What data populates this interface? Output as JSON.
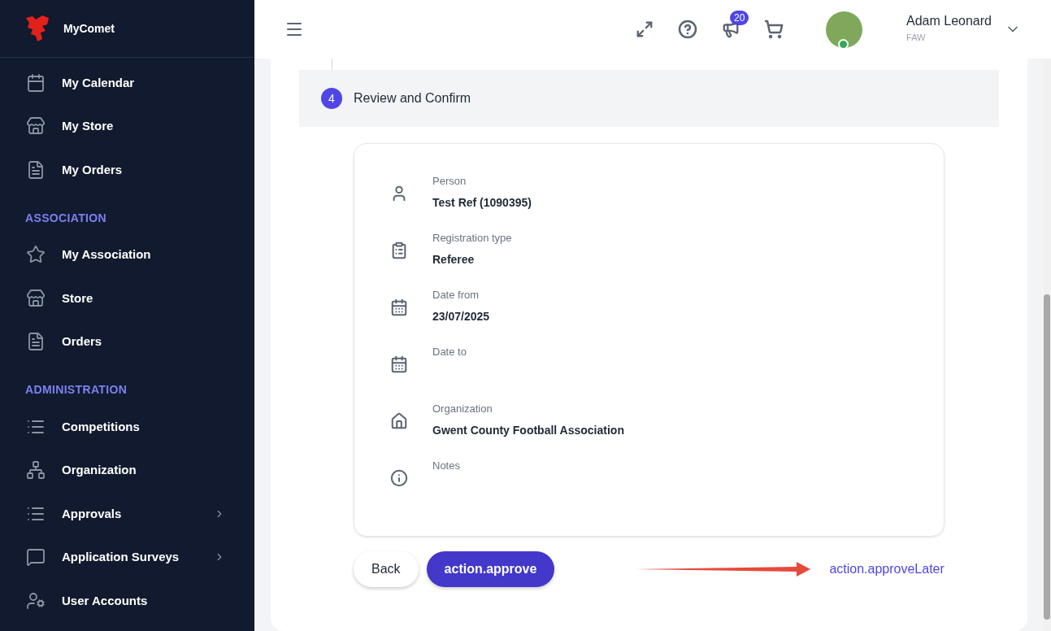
{
  "sidebar": {
    "brand": "MyComet",
    "sections": [
      {
        "items": [
          {
            "label": "My Calendar",
            "kind": "calendar",
            "has_submenu": false
          },
          {
            "label": "My Store",
            "kind": "store",
            "has_submenu": false
          },
          {
            "label": "My Orders",
            "kind": "invoice",
            "has_submenu": false
          }
        ]
      },
      {
        "heading": "ASSOCIATION",
        "items": [
          {
            "label": "My Association",
            "kind": "star",
            "has_submenu": false
          },
          {
            "label": "Store",
            "kind": "store",
            "has_submenu": false
          },
          {
            "label": "Orders",
            "kind": "invoice",
            "has_submenu": false
          }
        ]
      },
      {
        "heading": "ADMINISTRATION",
        "items": [
          {
            "label": "Competitions",
            "kind": "list",
            "has_submenu": false
          },
          {
            "label": "Organization",
            "kind": "network",
            "has_submenu": false
          },
          {
            "label": "Approvals",
            "kind": "list",
            "has_submenu": true
          },
          {
            "label": "Application Surveys",
            "kind": "chat",
            "has_submenu": true
          },
          {
            "label": "User Accounts",
            "kind": "usercog",
            "has_submenu": false
          }
        ]
      }
    ]
  },
  "header": {
    "notification_count": "20",
    "user": {
      "name": "Adam Leonard",
      "org": "FAW",
      "online": true
    }
  },
  "step": {
    "number": "4",
    "title": "Review and Confirm"
  },
  "fields": [
    {
      "kind": "person",
      "label": "Person",
      "value": "Test Ref (1090395)"
    },
    {
      "kind": "clipboard",
      "label": "Registration type",
      "value": "Referee"
    },
    {
      "kind": "calendar",
      "label": "Date from",
      "value": "23/07/2025"
    },
    {
      "kind": "calendar",
      "label": "Date to"
    },
    {
      "kind": "home",
      "label": "Organization",
      "value": "Gwent County Football Association"
    },
    {
      "kind": "info",
      "label": "Notes"
    }
  ],
  "actions": {
    "back": "Back",
    "approve": "action.approve",
    "approve_later": "action.approveLater"
  }
}
